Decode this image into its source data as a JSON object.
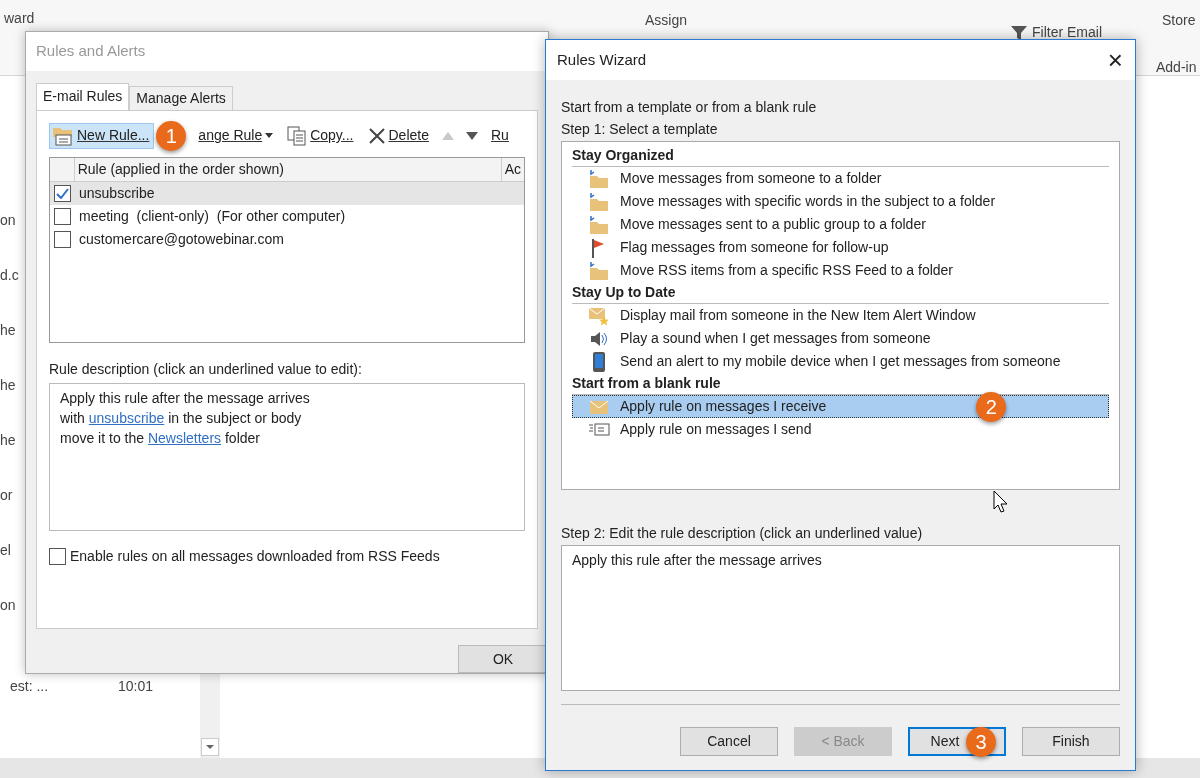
{
  "background": {
    "ribbon_fragments": [
      {
        "text": "ward",
        "kind": "left"
      },
      {
        "text": "Assign",
        "kind": "mid"
      },
      {
        "text": "Filter Email",
        "kind": "filter"
      },
      {
        "text": "Store",
        "kind": "right"
      },
      {
        "text": "Add-in",
        "kind": "rightlow"
      }
    ],
    "sidebar_fragments": [
      "on",
      "d.c",
      "he",
      "he",
      "he",
      "or",
      "el",
      "on"
    ],
    "message": {
      "subject": "est: ...",
      "time": "10:01"
    }
  },
  "rules_dialog": {
    "title": "Rules and Alerts",
    "tabs": [
      {
        "label": "E-mail Rules",
        "selected": true
      },
      {
        "label": "Manage Alerts",
        "selected": false
      }
    ],
    "toolbar": [
      {
        "label": "New Rule...",
        "kind": "new",
        "badge": "1"
      },
      {
        "label": "ange Rule",
        "kind": "dropdown"
      },
      {
        "label": "Copy...",
        "kind": "copy"
      },
      {
        "label": "Delete",
        "kind": "delete"
      },
      {
        "kind": "up"
      },
      {
        "kind": "down"
      },
      {
        "label": "Ru",
        "kind": "plain"
      }
    ],
    "columns": [
      "Rule (applied in the order shown)",
      "Ac"
    ],
    "rules": [
      {
        "name": "unsubscribe",
        "checked": true,
        "selected": true
      },
      {
        "name": "meeting  (client-only)  (For other computer)",
        "checked": false,
        "selected": false
      },
      {
        "name": "customercare@gotowebinar.com",
        "checked": false,
        "selected": false
      }
    ],
    "description_label": "Rule description (click an underlined value to edit):",
    "description": [
      [
        {
          "text": "Apply this rule after the message arrives",
          "link": false
        }
      ],
      [
        {
          "text": "with ",
          "link": false
        },
        {
          "text": "unsubscribe",
          "link": true
        },
        {
          "text": " in the subject or body",
          "link": false
        }
      ],
      [
        {
          "text": "move it to the ",
          "link": false
        },
        {
          "text": "Newsletters",
          "link": true
        },
        {
          "text": " folder",
          "link": false
        }
      ]
    ],
    "rss": {
      "label": "Enable rules on all messages downloaded from RSS Feeds",
      "checked": false
    },
    "ok": "OK"
  },
  "wizard": {
    "title": "Rules Wizard",
    "close": "×",
    "intro": "Start from a template or from a blank rule",
    "step1": "Step 1: Select a template",
    "groups": [
      {
        "title": "Stay Organized",
        "items": [
          {
            "label": "Move messages from someone to a folder",
            "kind": "folder",
            "selected": false
          },
          {
            "label": "Move messages with specific words in the subject to a folder",
            "kind": "folder",
            "selected": false
          },
          {
            "label": "Move messages sent to a public group to a folder",
            "kind": "folder",
            "selected": false
          },
          {
            "label": "Flag messages from someone for follow-up",
            "kind": "flag",
            "selected": false
          },
          {
            "label": "Move RSS items from a specific RSS Feed to a folder",
            "kind": "folder",
            "selected": false
          }
        ]
      },
      {
        "title": "Stay Up to Date",
        "items": [
          {
            "label": "Display mail from someone in the New Item Alert Window",
            "kind": "alert",
            "selected": false
          },
          {
            "label": "Play a sound when I get messages from someone",
            "kind": "sound",
            "selected": false
          },
          {
            "label": "Send an alert to my mobile device when I get messages from someone",
            "kind": "mobile",
            "selected": false
          }
        ]
      },
      {
        "title": "Start from a blank rule",
        "items": [
          {
            "label": "Apply rule on messages I receive",
            "kind": "receive",
            "selected": true,
            "badge": "2"
          },
          {
            "label": "Apply rule on messages I send",
            "kind": "send",
            "selected": false
          }
        ]
      }
    ],
    "step2": "Step 2: Edit the rule description (click an underlined value)",
    "step2_text": "Apply this rule after the message arrives",
    "buttons": [
      {
        "label": "Cancel",
        "disabled": false,
        "default": false
      },
      {
        "label": "< Back",
        "disabled": true,
        "default": false
      },
      {
        "label": "Next",
        "disabled": false,
        "default": true,
        "badge": "3"
      },
      {
        "label": "Finish",
        "disabled": false,
        "default": false
      }
    ]
  }
}
